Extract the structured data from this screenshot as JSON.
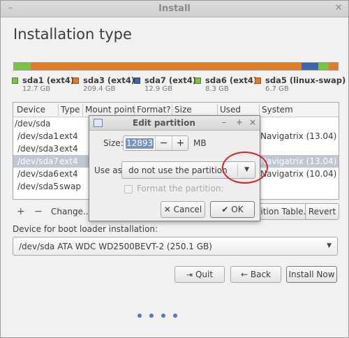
{
  "window": {
    "title": "Install",
    "min_glyph": "–",
    "close_glyph": "✕"
  },
  "page_title": "Installation type",
  "colors": {
    "ext4_selected": "#e07b2a",
    "ext4": "#e07b2a",
    "ext4_blue": "#3f64a8",
    "ext4_green": "#79c447",
    "swap": "#e07b2a",
    "selection": "#c0c7d4",
    "annotation_red": "#d2232a",
    "progress_dot_active": "#4a7dc9"
  },
  "partition_bar": [
    {
      "id": "sda1",
      "fraction": 0.051,
      "color": "#79c447"
    },
    {
      "id": "sda3",
      "fraction": 0.836,
      "color": "#e07b2a"
    },
    {
      "id": "sda7",
      "fraction": 0.052,
      "color": "#3f64a8"
    },
    {
      "id": "sda6",
      "fraction": 0.033,
      "color": "#79c447"
    },
    {
      "id": "sda5",
      "fraction": 0.028,
      "color": "#e07b2a"
    }
  ],
  "legend": [
    {
      "name": "sda1 (ext4)",
      "size": "12.7 GB",
      "color": "#79c447"
    },
    {
      "name": "sda3 (ext4)",
      "size": "209.4 GB",
      "color": "#e07b2a"
    },
    {
      "name": "sda7 (ext4)",
      "size": "12.9 GB",
      "color": "#3f64a8"
    },
    {
      "name": "sda6 (ext4)",
      "size": "8.3 GB",
      "color": "#79c447"
    },
    {
      "name": "sda5 (linux-swap)",
      "size": "6.7 GB",
      "color": "#e07b2a"
    }
  ],
  "table": {
    "columns": [
      "Device",
      "Type",
      "Mount point",
      "Format?",
      "Size",
      "Used",
      "System"
    ],
    "rows": [
      {
        "device": "/dev/sda",
        "type": "",
        "system": "",
        "selected": false
      },
      {
        "device": "/dev/sda1",
        "type": "ext4",
        "system": "Navigatrix (13.04)",
        "selected": false
      },
      {
        "device": "/dev/sda3",
        "type": "ext4",
        "system": "",
        "selected": false
      },
      {
        "device": "/dev/sda7",
        "type": "ext4",
        "system": "Navigatrix (13.04)",
        "selected": true
      },
      {
        "device": "/dev/sda6",
        "type": "ext4",
        "system": "Navigatrix (10.04)",
        "selected": false
      },
      {
        "device": "/dev/sda5",
        "type": "swap",
        "system": "",
        "selected": false
      }
    ]
  },
  "table_actions": {
    "add": "+",
    "remove": "−",
    "change": "Change...",
    "new_table": "ition Table...",
    "revert": "Revert"
  },
  "boot_loader": {
    "label": "Device for boot loader installation:",
    "value": "/dev/sda    ATA WDC WD2500BEVT-2 (250.1 GB)"
  },
  "nav": {
    "quit": "Quit",
    "back": "Back",
    "install": "Install Now"
  },
  "progress": {
    "steps": 4,
    "active": 4
  },
  "dialog": {
    "title": "Edit partition",
    "size_label": "Size:",
    "size_value": "12893",
    "size_unit": "MB",
    "minus": "−",
    "plus": "+",
    "use_as_label": "Use as:",
    "use_as_value": "do not use the partition",
    "format_label": "Format the partition:",
    "cancel": "Cancel",
    "ok": "OK",
    "tb_min": "–",
    "tb_max": "+",
    "tb_close": "×"
  }
}
